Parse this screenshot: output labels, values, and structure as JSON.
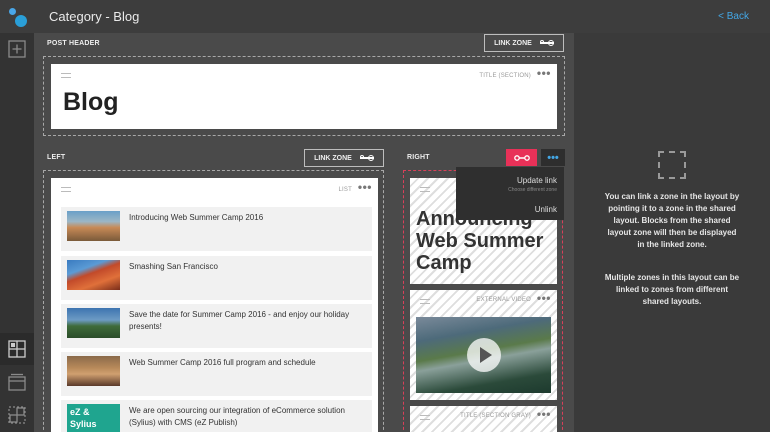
{
  "header": {
    "title": "Category - Blog",
    "back_label": "< Back"
  },
  "rail": {
    "items": [
      "add-icon",
      "layout-zones-icon",
      "shared-layout-icon",
      "link-zone-icon"
    ]
  },
  "zones": {
    "post_header": {
      "label": "POST HEADER",
      "link_button": "LINK ZONE",
      "block": {
        "type": "TITLE (SECTION)",
        "title": "Blog"
      }
    },
    "left": {
      "label": "LEFT",
      "link_button": "LINK ZONE",
      "block": {
        "type": "LIST",
        "items": [
          {
            "text": "Introducing Web Summer Camp 2016"
          },
          {
            "text": "Smashing San Francisco"
          },
          {
            "text": "Save the date for Summer Camp 2016 - and enjoy our holiday presents!"
          },
          {
            "text": "Web Summer Camp 2016 full program and schedule"
          },
          {
            "text": "We are open sourcing our integration of eCommerce solution (Sylius) with CMS (eZ Publish)",
            "thumb_text": "eZ & Sylius"
          }
        ]
      }
    },
    "right": {
      "label": "RIGHT",
      "accent_color": "#e83158",
      "menu": {
        "update_label": "Update link",
        "update_sub": "Choose different zone",
        "unlink_label": "Unlink"
      },
      "blocks": [
        {
          "type": "",
          "text": "Announcing Web Summer Camp"
        },
        {
          "type": "EXTERNAL VIDEO"
        },
        {
          "type": "TITLE (SECTION GRAY)"
        }
      ]
    }
  },
  "info": {
    "paragraph1": "You can link a zone in the layout by pointing it to a zone in the shared layout. Blocks from the shared layout zone will then be displayed in the linked zone.",
    "paragraph2": "Multiple zones in this layout can be linked to zones from different shared layouts."
  },
  "colors": {
    "link_blue": "#43a7e6",
    "accent_red": "#e83158",
    "logo_blue": "#2a9fd8"
  }
}
